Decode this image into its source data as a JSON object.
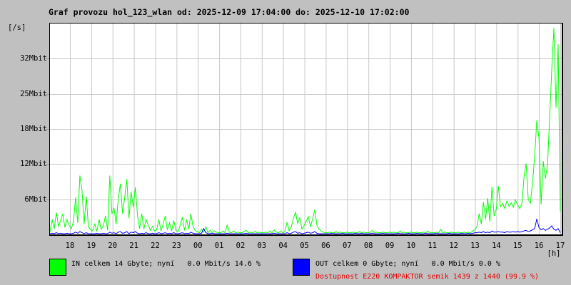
{
  "title": "Graf provozu hol_123_wlan od: 2025-12-09 17:04:00 do: 2025-12-10 17:02:00",
  "y_unit_label": "[/s]",
  "x_unit_label": "[h]",
  "colors": {
    "background": "#c0c0c0",
    "plot_background": "#ffffff",
    "grid": "#c8c8c8",
    "in_line": "#00ff00",
    "out_line": "#0000ff",
    "availability_text": "#e60000",
    "border": "#000000"
  },
  "legend": {
    "in_label": "IN celkem 14 Gbyte; nyní   0.0 Mbit/s 14.6 %",
    "out_label": "OUT celkem 0 Gbyte; nyní   0.0 Mbit/s 0.0 %",
    "availability": "Dostupnost E220 KOMPAKTOR semik 1439 z 1440 (99.9 %)"
  },
  "chart_data": {
    "type": "line",
    "title": "Graf provozu hol_123_wlan od: 2025-12-09 17:04:00 do: 2025-12-10 17:02:00",
    "x_start": "2025-12-09 17:04:00",
    "x_end": "2025-12-10 17:02:00",
    "x_tick_labels": [
      "18",
      "19",
      "20",
      "21",
      "22",
      "23",
      "00",
      "01",
      "02",
      "03",
      "04",
      "05",
      "06",
      "07",
      "08",
      "09",
      "10",
      "11",
      "12",
      "13",
      "14",
      "15",
      "16",
      "17"
    ],
    "y_tick_labels_top_to_bottom": [
      "32Mbit",
      "25Mbit",
      "18Mbit",
      "12Mbit",
      "6Mbit"
    ],
    "y_unit": "Mbit/s",
    "ylim": [
      0,
      36.6
    ],
    "grid": true,
    "legend_position": "bottom",
    "sample_interval_minutes": 6,
    "series": [
      {
        "name": "IN",
        "color": "#00ff00",
        "values": [
          0.4,
          2.6,
          1.0,
          3.8,
          1.4,
          2.4,
          3.6,
          1.2,
          2.6,
          1.6,
          1.0,
          2.2,
          6.4,
          2.0,
          10.2,
          7.6,
          1.8,
          6.6,
          1.4,
          0.8,
          0.6,
          1.8,
          0.5,
          2.6,
          0.9,
          1.5,
          3.2,
          0.7,
          10.2,
          3.6,
          4.6,
          1.8,
          6.2,
          8.8,
          3.6,
          6.4,
          9.6,
          2.8,
          7.4,
          4.8,
          8.2,
          3.2,
          1.0,
          3.6,
          0.9,
          2.6,
          1.6,
          0.7,
          1.4,
          0.6,
          0.8,
          2.6,
          0.6,
          1.8,
          3.2,
          0.8,
          2.0,
          0.6,
          2.4,
          0.7,
          0.5,
          1.6,
          3.0,
          0.7,
          2.6,
          0.9,
          3.6,
          1.4,
          0.7,
          0.5,
          0.3,
          0.9,
          0.4,
          1.3,
          0.3,
          0.7,
          0.3,
          0.6,
          0.4,
          0.3,
          0.3,
          0.6,
          0.3,
          1.6,
          0.4,
          0.3,
          0.6,
          0.3,
          0.4,
          0.3,
          0.3,
          0.5,
          0.7,
          0.3,
          0.4,
          0.3,
          0.5,
          0.3,
          0.4,
          0.3,
          0.3,
          0.4,
          0.3,
          0.6,
          0.3,
          0.8,
          0.4,
          0.3,
          0.6,
          0.3,
          0.5,
          2.1,
          0.6,
          1.3,
          2.7,
          3.9,
          1.9,
          2.9,
          0.9,
          1.5,
          2.3,
          3.1,
          1.3,
          2.7,
          4.3,
          1.6,
          0.9,
          0.6,
          0.4,
          0.3,
          0.3,
          0.4,
          0.3,
          0.3,
          0.5,
          0.3,
          0.4,
          0.3,
          0.3,
          0.4,
          0.3,
          0.3,
          0.4,
          0.3,
          0.3,
          0.5,
          0.3,
          0.4,
          0.3,
          0.3,
          0.4,
          0.7,
          0.3,
          0.4,
          0.3,
          0.3,
          0.4,
          0.3,
          0.3,
          0.4,
          0.3,
          0.4,
          0.3,
          0.3,
          0.6,
          0.3,
          0.4,
          0.3,
          0.3,
          0.4,
          0.3,
          0.3,
          0.4,
          0.3,
          0.3,
          0.4,
          0.3,
          0.6,
          0.3,
          0.3,
          0.3,
          0.4,
          0.3,
          0.9,
          0.3,
          0.4,
          0.3,
          0.3,
          0.4,
          0.3,
          0.3,
          0.4,
          0.3,
          0.3,
          0.4,
          0.3,
          0.4,
          0.3,
          0.6,
          0.8,
          1.4,
          3.6,
          1.8,
          5.6,
          2.6,
          6.3,
          2.2,
          8.3,
          3.2,
          4.4,
          8.4,
          4.8,
          5.4,
          4.5,
          5.8,
          4.9,
          5.5,
          4.7,
          6.0,
          5.1,
          4.5,
          5.3,
          9.8,
          12.3,
          6.1,
          5.4,
          8.9,
          13.6,
          19.8,
          16.8,
          5.2,
          12.7,
          9.7,
          12.0,
          20.0,
          28.5,
          35.8,
          22.0,
          33.0,
          4.0
        ]
      },
      {
        "name": "OUT",
        "color": "#0000ff",
        "values": [
          0.1,
          0.2,
          0.1,
          0.3,
          0.1,
          0.2,
          0.1,
          0.1,
          0.2,
          0.1,
          0.1,
          0.2,
          0.4,
          0.2,
          0.5,
          0.3,
          0.1,
          0.3,
          0.1,
          0.1,
          0.1,
          0.1,
          0.2,
          0.1,
          0.1,
          0.2,
          0.1,
          0.1,
          0.4,
          0.2,
          0.3,
          0.1,
          0.4,
          0.5,
          0.2,
          0.3,
          0.5,
          0.1,
          0.4,
          0.3,
          0.5,
          0.2,
          0.1,
          0.2,
          0.1,
          0.3,
          0.1,
          0.1,
          0.2,
          0.1,
          0.1,
          0.3,
          0.1,
          0.2,
          0.3,
          0.1,
          0.2,
          0.1,
          0.3,
          0.1,
          0.1,
          0.2,
          0.3,
          0.1,
          0.2,
          0.1,
          0.4,
          0.2,
          0.1,
          0.1,
          0.1,
          0.2,
          1.0,
          0.3,
          0.1,
          0.1,
          0.2,
          0.1,
          0.1,
          0.1,
          0.1,
          0.1,
          0.1,
          0.2,
          0.1,
          0.1,
          0.1,
          0.1,
          0.1,
          0.1,
          0.1,
          0.1,
          0.2,
          0.1,
          0.1,
          0.1,
          0.1,
          0.1,
          0.1,
          0.1,
          0.1,
          0.1,
          0.1,
          0.1,
          0.1,
          0.2,
          0.1,
          0.1,
          0.1,
          0.1,
          0.1,
          0.3,
          0.1,
          0.2,
          0.4,
          0.5,
          0.2,
          0.3,
          0.1,
          0.2,
          0.3,
          0.4,
          0.2,
          0.3,
          0.5,
          0.2,
          0.1,
          0.1,
          0.1,
          0.1,
          0.1,
          0.1,
          0.2,
          0.1,
          0.1,
          0.1,
          0.1,
          0.2,
          0.1,
          0.1,
          0.1,
          0.1,
          0.1,
          0.2,
          0.1,
          0.1,
          0.2,
          0.1,
          0.1,
          0.1,
          0.1,
          0.2,
          0.1,
          0.1,
          0.1,
          0.1,
          0.2,
          0.1,
          0.1,
          0.1,
          0.1,
          0.1,
          0.1,
          0.2,
          0.1,
          0.1,
          0.1,
          0.1,
          0.2,
          0.1,
          0.1,
          0.1,
          0.2,
          0.1,
          0.1,
          0.1,
          0.2,
          0.1,
          0.1,
          0.1,
          0.1,
          0.2,
          0.1,
          0.1,
          0.1,
          0.1,
          0.1,
          0.2,
          0.1,
          0.1,
          0.1,
          0.1,
          0.1,
          0.2,
          0.1,
          0.1,
          0.2,
          0.1,
          0.2,
          0.3,
          0.3,
          0.4,
          0.3,
          0.5,
          0.3,
          0.4,
          0.3,
          0.6,
          0.4,
          0.4,
          0.5,
          0.4,
          0.4,
          0.3,
          0.5,
          0.4,
          0.4,
          0.5,
          0.4,
          0.5,
          0.4,
          0.5,
          0.6,
          0.7,
          0.5,
          0.6,
          0.8,
          1.0,
          2.7,
          1.2,
          0.8,
          1.0,
          0.7,
          0.9,
          1.1,
          1.5,
          0.9,
          0.7,
          1.0,
          0.3
        ]
      }
    ]
  }
}
